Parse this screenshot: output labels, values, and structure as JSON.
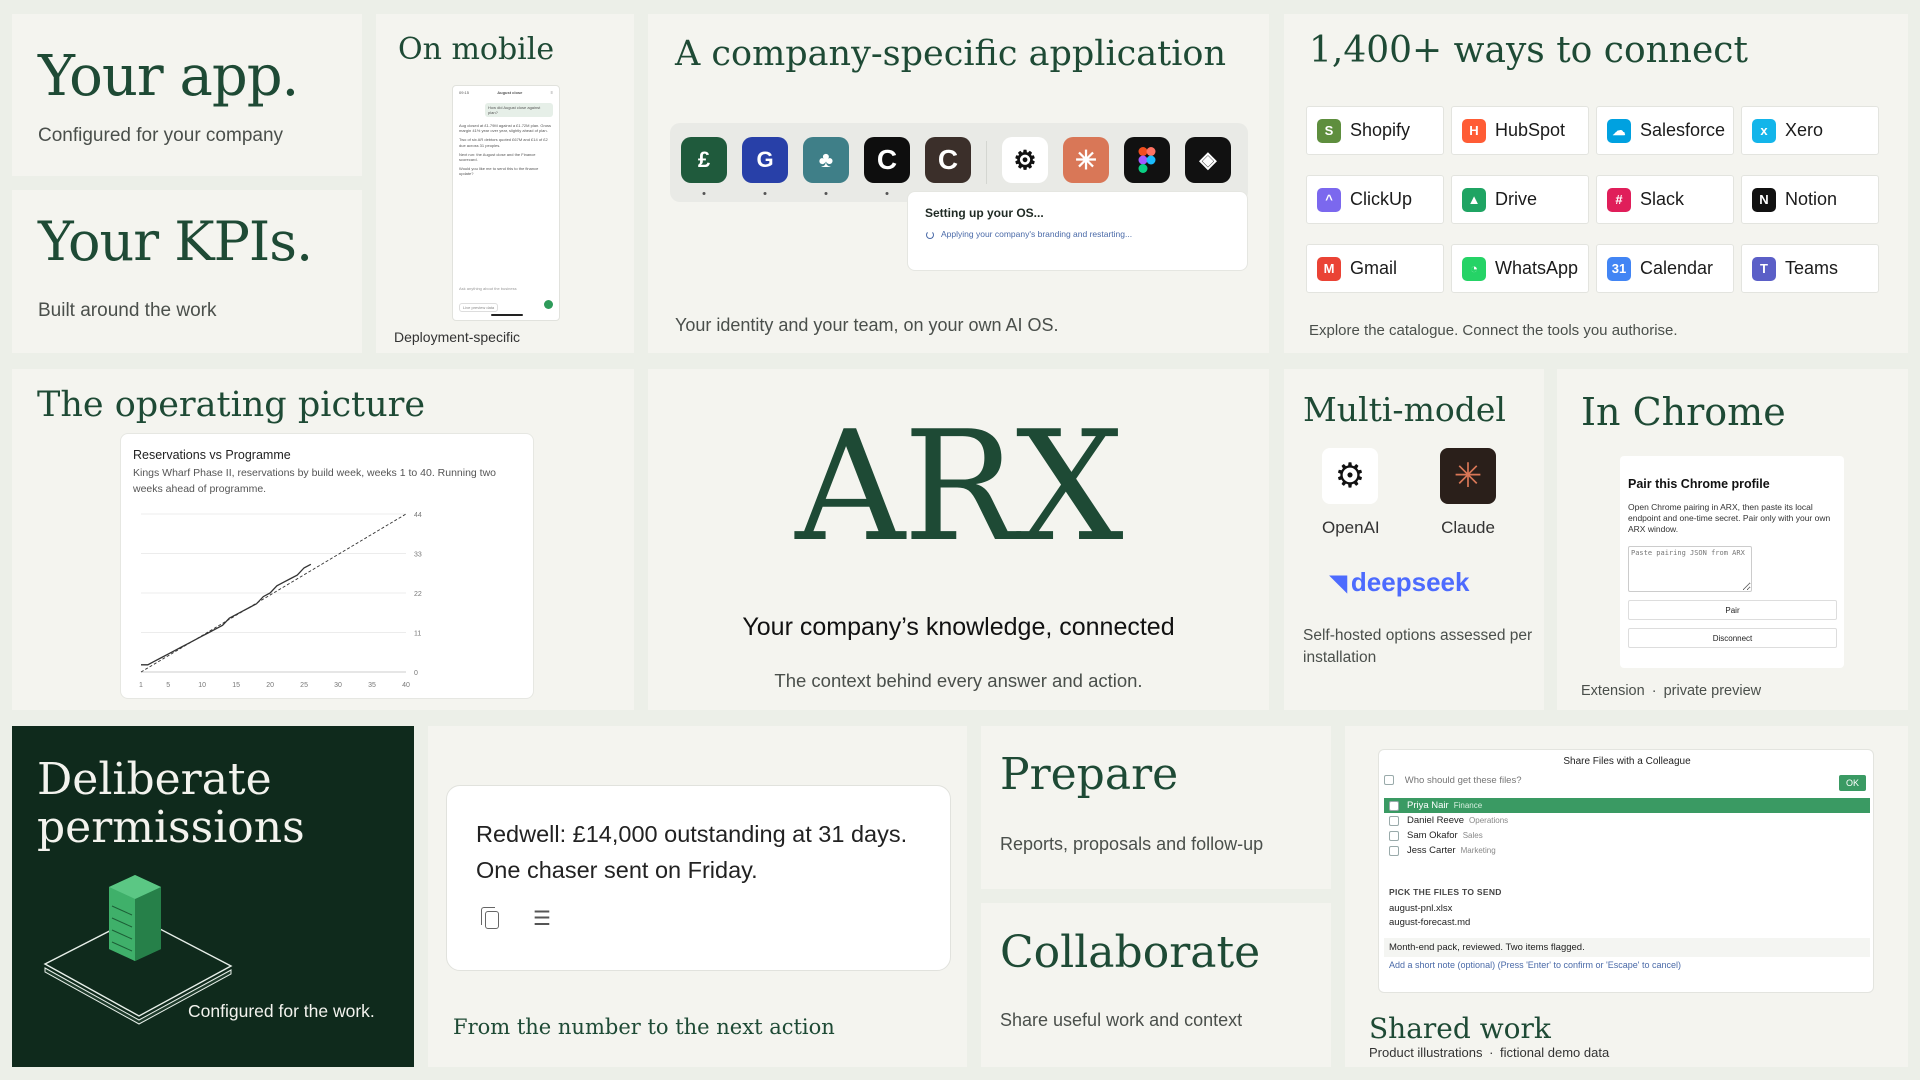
{
  "your_app": {
    "title": "Your app.",
    "subtitle": "Configured for your company"
  },
  "your_kpis": {
    "title": "Your KPIs.",
    "subtitle": "Built around the work"
  },
  "on_mobile": {
    "title": "On mobile",
    "caption": "Deployment-specific",
    "phone": {
      "time": "09:15",
      "header": "August close",
      "bubble": "How did August close against plan?",
      "answer": "Aug closed at £1.79M against a £1.72M plan. Gross margin 41% year over year, slightly ahead of plan.",
      "answer2": "Two of six AR debtors quoted £67M and £14 of £2 due across 31 peoples.",
      "answer3": "Next run: the August close and the Finance scorecard.",
      "answer4": "Would you like me to send this to the finance update?",
      "input_placeholder": "Ask anything about the business",
      "footer": "Live preview data"
    }
  },
  "company_app": {
    "title": "A company-specific application",
    "caption": "Your identity and your team, on your own AI OS.",
    "setup_title": "Setting up your OS...",
    "setup_status": "Applying your company's branding and restarting..."
  },
  "connect": {
    "title": "1,400+ ways to connect",
    "caption": "Explore the catalogue. Connect the tools you authorise.",
    "items": [
      {
        "label": "Shopify",
        "icon": "shopify-icon",
        "color": "#5e8e3e"
      },
      {
        "label": "HubSpot",
        "icon": "hubspot-icon",
        "color": "#ff5c35"
      },
      {
        "label": "Salesforce",
        "icon": "salesforce-icon",
        "color": "#00a1e0"
      },
      {
        "label": "Xero",
        "icon": "xero-icon",
        "color": "#13b5ea"
      },
      {
        "label": "ClickUp",
        "icon": "clickup-icon",
        "color": "#7b68ee"
      },
      {
        "label": "Drive",
        "icon": "drive-icon",
        "color": "#1fa463"
      },
      {
        "label": "Slack",
        "icon": "slack-icon",
        "color": "#e01e5a"
      },
      {
        "label": "Notion",
        "icon": "notion-icon",
        "color": "#111111"
      },
      {
        "label": "Gmail",
        "icon": "gmail-icon",
        "color": "#ea4335"
      },
      {
        "label": "WhatsApp",
        "icon": "whatsapp-icon",
        "color": "#25d366"
      },
      {
        "label": "Calendar",
        "icon": "calendar-icon",
        "color": "#4285f4"
      },
      {
        "label": "Teams",
        "icon": "teams-icon",
        "color": "#5b5fc7"
      }
    ]
  },
  "operating": {
    "title": "The operating picture"
  },
  "chart_data": {
    "type": "line",
    "title": "Reservations vs Programme",
    "subtitle": "Kings Wharf Phase II, reservations by build week, weeks 1 to 40. Running two weeks ahead of programme.",
    "xlim": [
      1,
      40
    ],
    "ylim": [
      0,
      44
    ],
    "x_ticks": [
      "1",
      "5",
      "10",
      "15",
      "20",
      "25",
      "30",
      "35",
      "40"
    ],
    "y_ticks": [
      "0",
      "11",
      "22",
      "33",
      "44"
    ],
    "grid": true,
    "series": [
      {
        "style": "solid",
        "x": [
          1,
          2,
          3,
          4,
          5,
          6,
          7,
          8,
          9,
          10,
          11,
          12,
          13,
          14,
          15,
          16,
          17,
          18,
          19,
          20,
          21,
          22,
          23,
          24,
          25,
          26
        ],
        "y": [
          2,
          2,
          3,
          4,
          5,
          6,
          7,
          8,
          9,
          10,
          11,
          12,
          13,
          15,
          16,
          17,
          18,
          19,
          21,
          22,
          24,
          25,
          26,
          27,
          29,
          30
        ]
      },
      {
        "style": "dashed",
        "x": [
          1,
          40
        ],
        "y": [
          0,
          44
        ]
      }
    ]
  },
  "arx": {
    "logo": "ARX",
    "headline": "Your company’s knowledge, connected",
    "subline": "The context behind every answer and action."
  },
  "multi_model": {
    "title": "Multi-model",
    "models": [
      "OpenAI",
      "Claude"
    ],
    "deepseek": "deepseek",
    "caption": "Self-hosted options assessed per installation"
  },
  "chrome": {
    "title": "In Chrome",
    "panel_title": "Pair this Chrome profile",
    "panel_text": "Open Chrome pairing in ARX, then paste its local endpoint and one-time secret. Pair only with your own ARX window.",
    "textarea_placeholder": "Paste pairing JSON from ARX",
    "pair": "Pair",
    "disconnect": "Disconnect",
    "caption_a": "Extension",
    "caption_sep": "·",
    "caption_b": "private preview"
  },
  "permissions": {
    "title_line1": "Deliberate",
    "title_line2": "permissions",
    "caption": "Configured for the work.",
    "colors": {
      "bg": "#0f2a1c",
      "server": "#2e9b5a"
    }
  },
  "action": {
    "message": "Redwell: £14,000 outstanding at 31 days. One chaser sent on Friday.",
    "caption": "From the number to the next action"
  },
  "prepare": {
    "title": "Prepare",
    "caption": "Reports, proposals and follow-up"
  },
  "collaborate": {
    "title": "Collaborate",
    "caption": "Share useful work and context"
  },
  "share": {
    "dialog_title": "Share Files with a Colleague",
    "search_placeholder": "Who should get these files?",
    "ok": "OK",
    "people": [
      {
        "name": "Priya Nair",
        "dept": "Finance",
        "selected": true
      },
      {
        "name": "Daniel Reeve",
        "dept": "Operations",
        "selected": false
      },
      {
        "name": "Sam Okafor",
        "dept": "Sales",
        "selected": false
      },
      {
        "name": "Jess Carter",
        "dept": "Marketing",
        "selected": false
      }
    ],
    "files_header": "PICK THE FILES TO SEND",
    "files": [
      "august-pnl.xlsx",
      "august-forecast.md"
    ],
    "note": "Month-end pack, reviewed. Two items flagged.",
    "note_hint": "Add a short note (optional) (Press 'Enter' to confirm or 'Escape' to cancel)",
    "title": "Shared work",
    "caption_a": "Product illustrations",
    "caption_sep": "·",
    "caption_b": "fictional demo data"
  }
}
